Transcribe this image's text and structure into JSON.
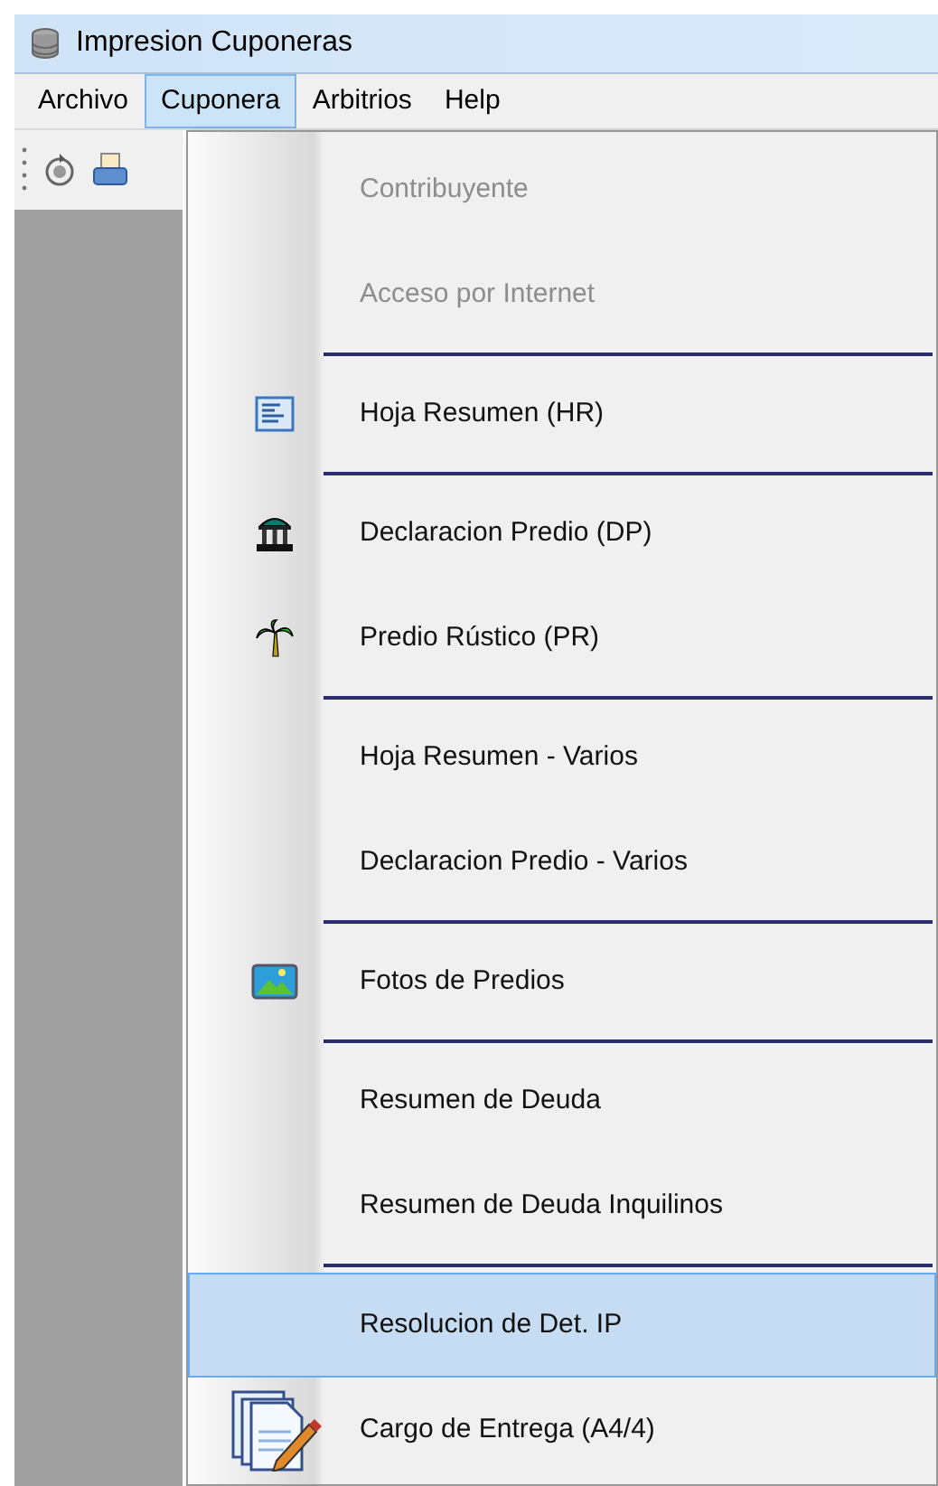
{
  "window": {
    "title": "Impresion Cuponeras"
  },
  "menubar": [
    {
      "label": "Archivo",
      "selected": false
    },
    {
      "label": "Cuponera",
      "selected": true
    },
    {
      "label": "Arbitrios",
      "selected": false
    },
    {
      "label": "Help",
      "selected": false
    }
  ],
  "menu": [
    {
      "kind": "item",
      "label": "Contribuyente",
      "disabled": true,
      "selected": false
    },
    {
      "kind": "item",
      "label": "Acceso por Internet",
      "disabled": true,
      "selected": false
    },
    {
      "kind": "separator"
    },
    {
      "kind": "item",
      "label": "Hoja Resumen (HR)",
      "disabled": false,
      "selected": false
    },
    {
      "kind": "separator"
    },
    {
      "kind": "item",
      "label": "Declaracion Predio (DP)",
      "disabled": false,
      "selected": false
    },
    {
      "kind": "item",
      "label": "Predio Rústico (PR)",
      "disabled": false,
      "selected": false
    },
    {
      "kind": "separator"
    },
    {
      "kind": "item",
      "label": "Hoja Resumen - Varios",
      "disabled": false,
      "selected": false
    },
    {
      "kind": "item",
      "label": "Declaracion Predio - Varios",
      "disabled": false,
      "selected": false
    },
    {
      "kind": "separator"
    },
    {
      "kind": "item",
      "label": "Fotos de Predios",
      "disabled": false,
      "selected": false
    },
    {
      "kind": "separator"
    },
    {
      "kind": "item",
      "label": "Resumen de Deuda",
      "disabled": false,
      "selected": false
    },
    {
      "kind": "item",
      "label": "Resumen de Deuda Inquilinos",
      "disabled": false,
      "selected": false
    },
    {
      "kind": "separator"
    },
    {
      "kind": "item",
      "label": "Resolucion de Det. IP",
      "disabled": false,
      "selected": true
    },
    {
      "kind": "item",
      "label": "Cargo de Entrega (A4/4)",
      "disabled": false,
      "selected": false
    }
  ]
}
